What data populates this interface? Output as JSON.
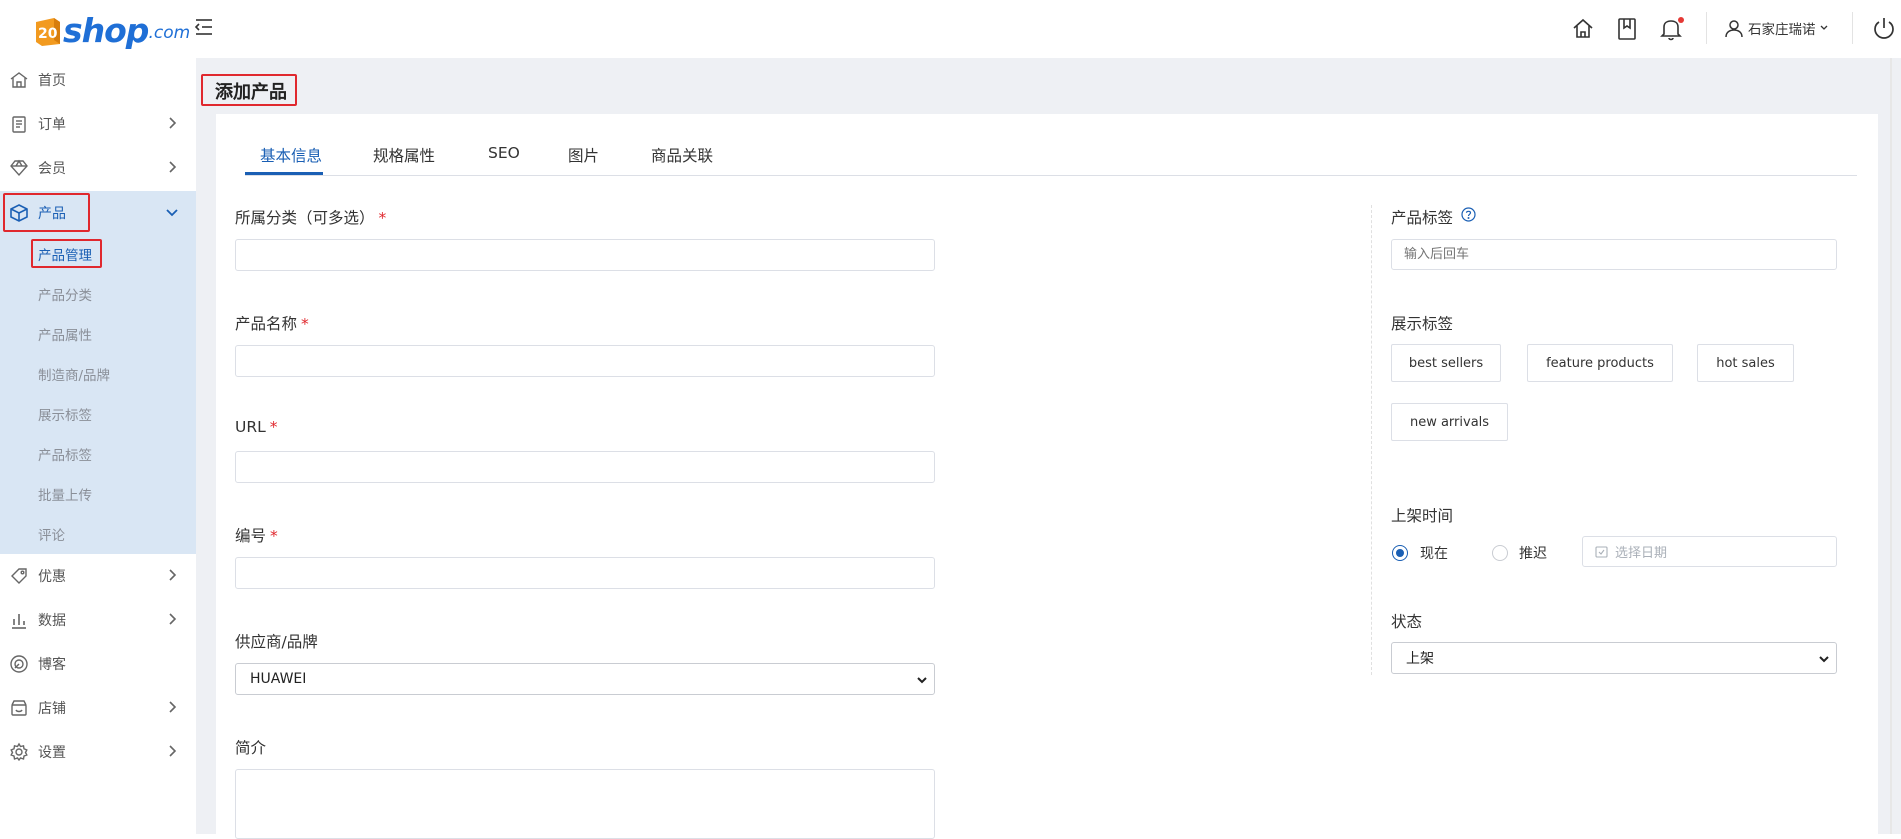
{
  "brand": {
    "logo_badge": "20",
    "logo_text": "shop",
    "logo_suffix": ".com",
    "color": "#1f6fd6",
    "badge_color": "#f29a1f"
  },
  "topbar": {
    "icons": [
      "home-icon",
      "bookmark-icon",
      "bell-icon",
      "power-icon"
    ],
    "user_name": "石家庄瑞诺"
  },
  "sidebar": {
    "items": [
      {
        "label": "首页",
        "icon": "home-icon"
      },
      {
        "label": "订单",
        "icon": "order-icon"
      },
      {
        "label": "会员",
        "icon": "member-icon"
      },
      {
        "label": "产品",
        "icon": "product-cube-icon"
      },
      {
        "label": "优惠",
        "icon": "discount-tag-icon"
      },
      {
        "label": "数据",
        "icon": "chart-icon"
      },
      {
        "label": "博客",
        "icon": "blog-icon"
      },
      {
        "label": "店铺",
        "icon": "store-icon"
      },
      {
        "label": "设置",
        "icon": "gear-icon"
      }
    ],
    "product_sub": [
      "产品管理",
      "产品分类",
      "产品属性",
      "制造商/品牌",
      "展示标签",
      "产品标签",
      "批量上传",
      "评论"
    ],
    "active_color": "#1a5fb4",
    "open_bg": "#d9e6f4"
  },
  "page": {
    "title": "添加产品",
    "tabs": [
      "基本信息",
      "规格属性",
      "SEO",
      "图片",
      "商品关联"
    ]
  },
  "form": {
    "category_label": "所属分类（可多选）",
    "name_label": "产品名称",
    "url_label": "URL",
    "code_label": "编号",
    "required_mark": "*",
    "supplier_label": "供应商/品牌",
    "supplier_value": "HUAWEI",
    "intro_label": "简介",
    "product_tags_label": "产品标签",
    "product_tags_placeholder": "输入后回车",
    "display_tags_label": "展示标签",
    "display_tags": [
      "best sellers",
      "feature products",
      "hot sales",
      "new arrivals"
    ],
    "listing_time_label": "上架时间",
    "listing_now": "现在",
    "listing_later": "推迟",
    "date_placeholder": "选择日期",
    "status_label": "状态",
    "status_value": "上架"
  },
  "colors": {
    "highlight_box": "#e0282e",
    "required": "#e0282e",
    "accent": "#1a5fb4",
    "notif_dot": "#e53935"
  }
}
